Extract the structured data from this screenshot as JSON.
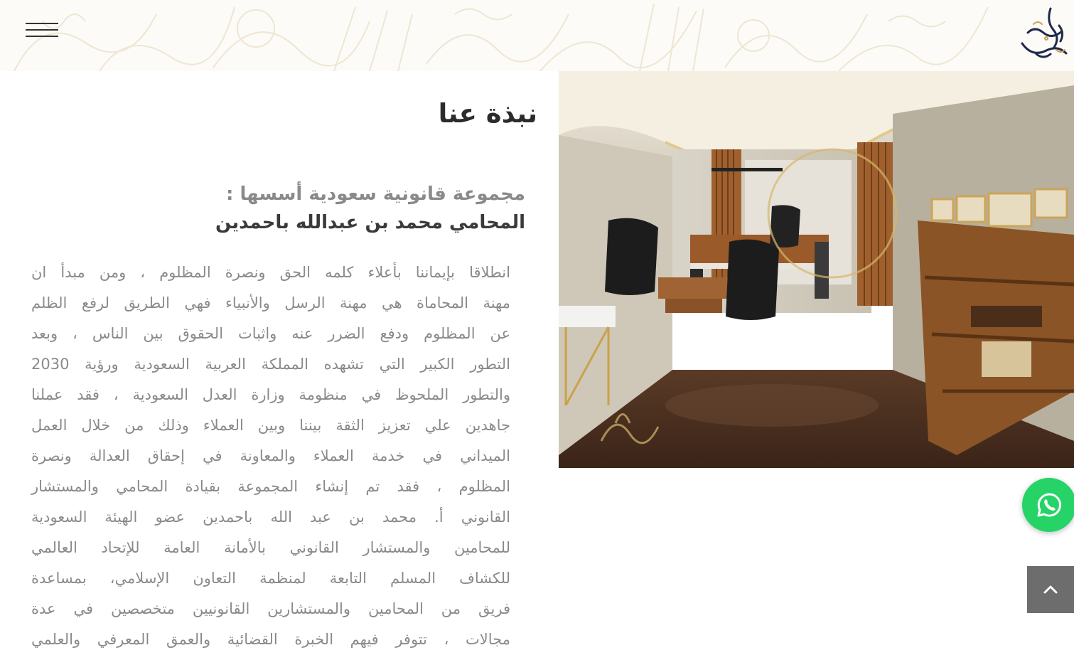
{
  "header": {
    "menu_icon": "hamburger-menu-icon",
    "logo_icon": "calligraphy-logo-icon",
    "background_color": "#fcfbf8",
    "pattern_color": "#efe6d2"
  },
  "about": {
    "title": "نبذة عنا",
    "subtitle_line1": "مجموعة قانونية سعودية أسسها :",
    "subtitle_line2": "المحامي محمد بن عبدالله باحمدين",
    "body_lines": [
      "انطلاقا بإيماننا بأعلاء كلمه الحق ونصرة المظلوم ، ومن مبدأ ان",
      "مهنة المحاماة هي مهنة الرسل والأنبياء فهي الطريق لرفع الظلم",
      "عن المظلوم ودفع الضرر عنه واثبات الحقوق بين الناس ، وبعد",
      "التطور الكبير التي تشهده المملكة العربية السعودية ورؤية 2030",
      "والتطور الملحوظ في منظومة وزارة العدل السعودية ، فقد عملنا",
      "جاهدين علي تعزيز الثقة بيننا وبين العملاء وذلك من خلال العمل",
      "الميداني في خدمة العملاء والمعاونة في إحقاق العدالة ونصرة",
      "المظلوم ، فقد تم إنشاء المجموعة بقيادة المحامي والمستشار",
      "القانوني أ. محمد بن عبد الله باحمدين عضو الهيئة السعودية",
      "للمحامين والمستشار القانوني بالأمانة العامة للإتحاد العالمي",
      "للكشاف المسلم التابعة لمنظمة التعاون الإسلامي، بمساعدة",
      "فريق من المحامين والمستشارين القانونيين متخصصين في عدة",
      "مجالات ، تتوفر فيهم الخبرة القضائية والعمق المعرفي والعلمي"
    ]
  },
  "office_image": {
    "description_icon": "office-photo"
  },
  "floating": {
    "whatsapp_icon": "whatsapp-icon",
    "whatsapp_color": "#25d366",
    "back_to_top_icon": "chevron-up-icon",
    "back_to_top_color": "#6d6d6d"
  }
}
